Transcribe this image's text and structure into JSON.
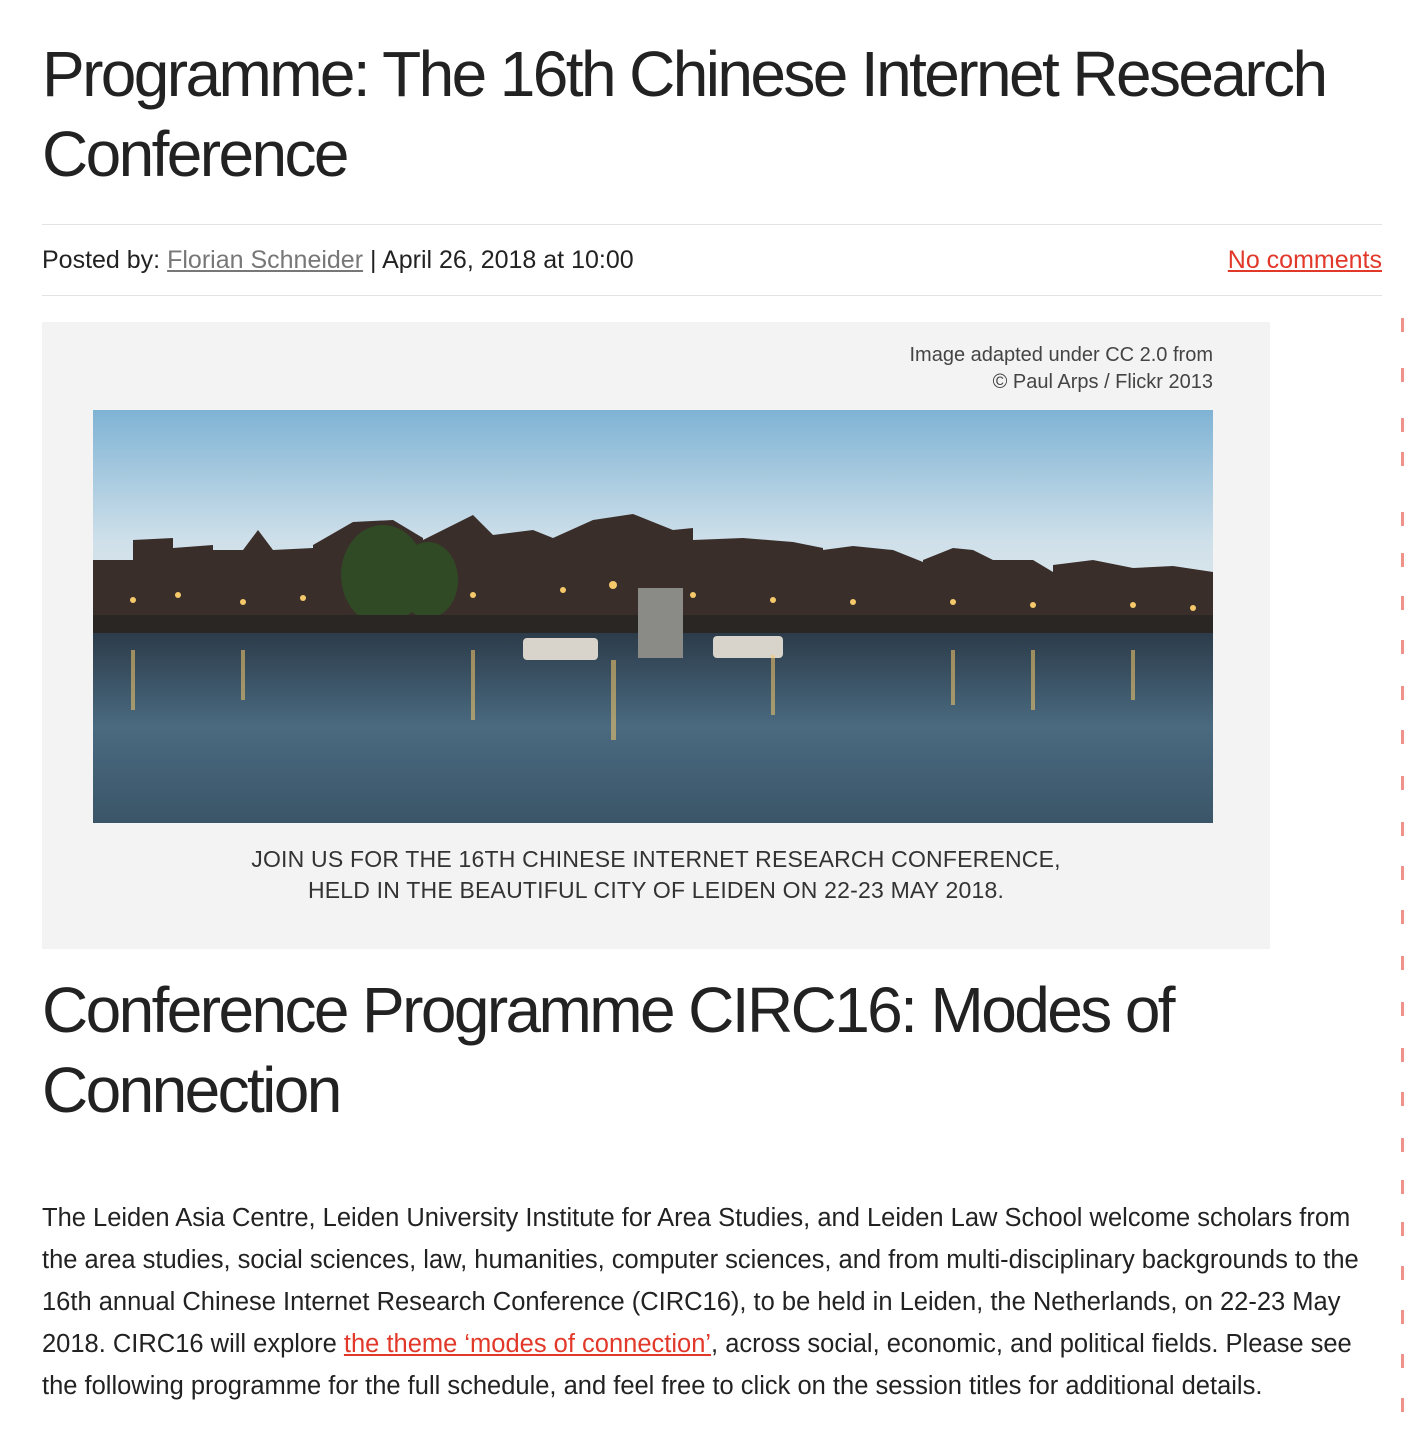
{
  "post": {
    "title": "Programme: The 16th Chinese Internet Research Conference",
    "posted_by_label": "Posted by:",
    "author": "Florian Schneider",
    "separator": "|",
    "date": "April 26, 2018 at 10:00",
    "comments": "No comments"
  },
  "banner": {
    "credit_line1": "Image adapted under CC 2.0 from",
    "credit_line2": "© Paul Arps / Flickr 2013",
    "caption_line1": "JOIN US FOR THE 16TH CHINESE INTERNET RESEARCH CONFERENCE,",
    "caption_line2": "HELD IN THE BEAUTIFUL CITY OF LEIDEN ON 22-23 MAY 2018."
  },
  "section": {
    "heading": "Conference Programme CIRC16: Modes of Connection",
    "intro_before_link": "The Leiden Asia Centre, Leiden University Institute for Area Studies, and Leiden Law School welcome scholars from the area studies, social sciences, law, humanities, computer sciences, and from multi-disciplinary backgrounds to the 16th annual Chinese Internet Research Conference (CIRC16), to be held in Leiden, the Netherlands, on 22-23 May 2018. CIRC16 will explore ",
    "intro_link": "the theme ‘modes of connection’",
    "intro_after_link": ", across social, economic, and political fields. Please see the following programme for the full schedule, and feel free to click on the session titles for additional details."
  },
  "colors": {
    "link_accent": "#e2382a",
    "author_link": "#777777",
    "text": "#222222",
    "banner_bg": "#f3f3f3"
  }
}
